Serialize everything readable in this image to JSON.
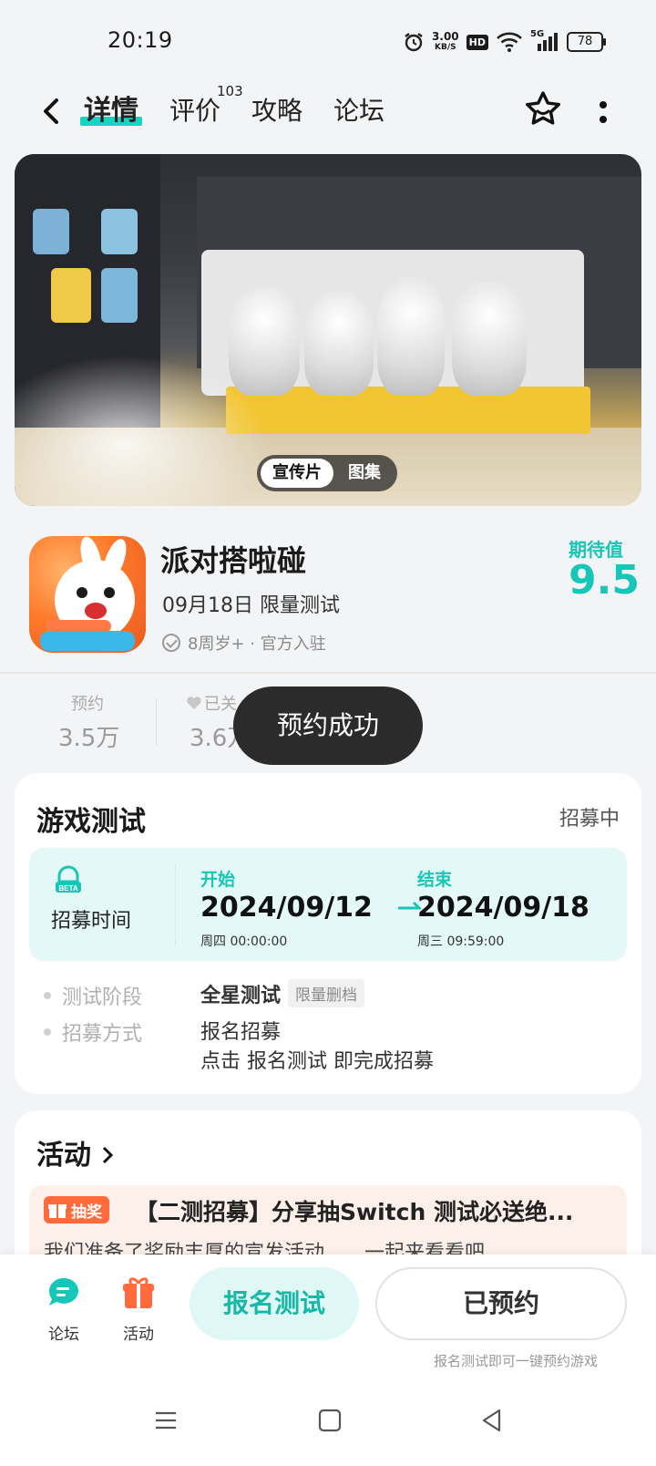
{
  "status": {
    "time": "20:19",
    "net_speed_value": "3.00",
    "net_speed_unit": "KB/S",
    "hd": "HD",
    "network": "5G",
    "battery": "78"
  },
  "nav": {
    "tabs": [
      {
        "label": "详情"
      },
      {
        "label": "评价",
        "badge": "103"
      },
      {
        "label": "攻略"
      },
      {
        "label": "论坛"
      }
    ]
  },
  "hero": {
    "tabs": [
      "宣传片",
      "图集"
    ],
    "active_tab": "宣传片"
  },
  "game": {
    "title": "派对搭啦碰",
    "date_line": "09月18日 限量测试",
    "meta": "8周岁+ · 官方入驻",
    "expect_label": "期待值",
    "expect_score": "9.5"
  },
  "stats": [
    {
      "label": "预约",
      "value": "3.5万"
    },
    {
      "label": "已关",
      "value": "3.6万"
    }
  ],
  "toast": "预约成功",
  "test_card": {
    "title": "游戏测试",
    "status": "招募中",
    "recruit_label": "招募时间",
    "start": {
      "label": "开始",
      "date": "2024/09/12",
      "sub": "周四  00:00:00"
    },
    "end": {
      "label": "结束",
      "date": "2024/09/18",
      "sub": "周三  09:59:00"
    },
    "rows": [
      {
        "label": "测试阶段",
        "value": "全星测试",
        "tag": "限量删档"
      },
      {
        "label": "招募方式",
        "value": "报名招募",
        "extra": "点击 报名测试 即完成招募"
      }
    ]
  },
  "activity": {
    "title": "活动",
    "badge": "抽奖",
    "headline": "【二测招募】分享抽Switch 测试必送绝...",
    "desc": "我们准备了奖励丰厚的宣发活动……一起来看看吧"
  },
  "bottom": {
    "forum_label": "论坛",
    "activity_label": "活动",
    "signup_label": "报名测试",
    "reserved_label": "已预约",
    "hint": "报名测试即可一键预约游戏"
  },
  "colors": {
    "accent": "#17c6b6",
    "toast_bg": "#2b2b2b",
    "lottery": "#ff6b3d"
  }
}
